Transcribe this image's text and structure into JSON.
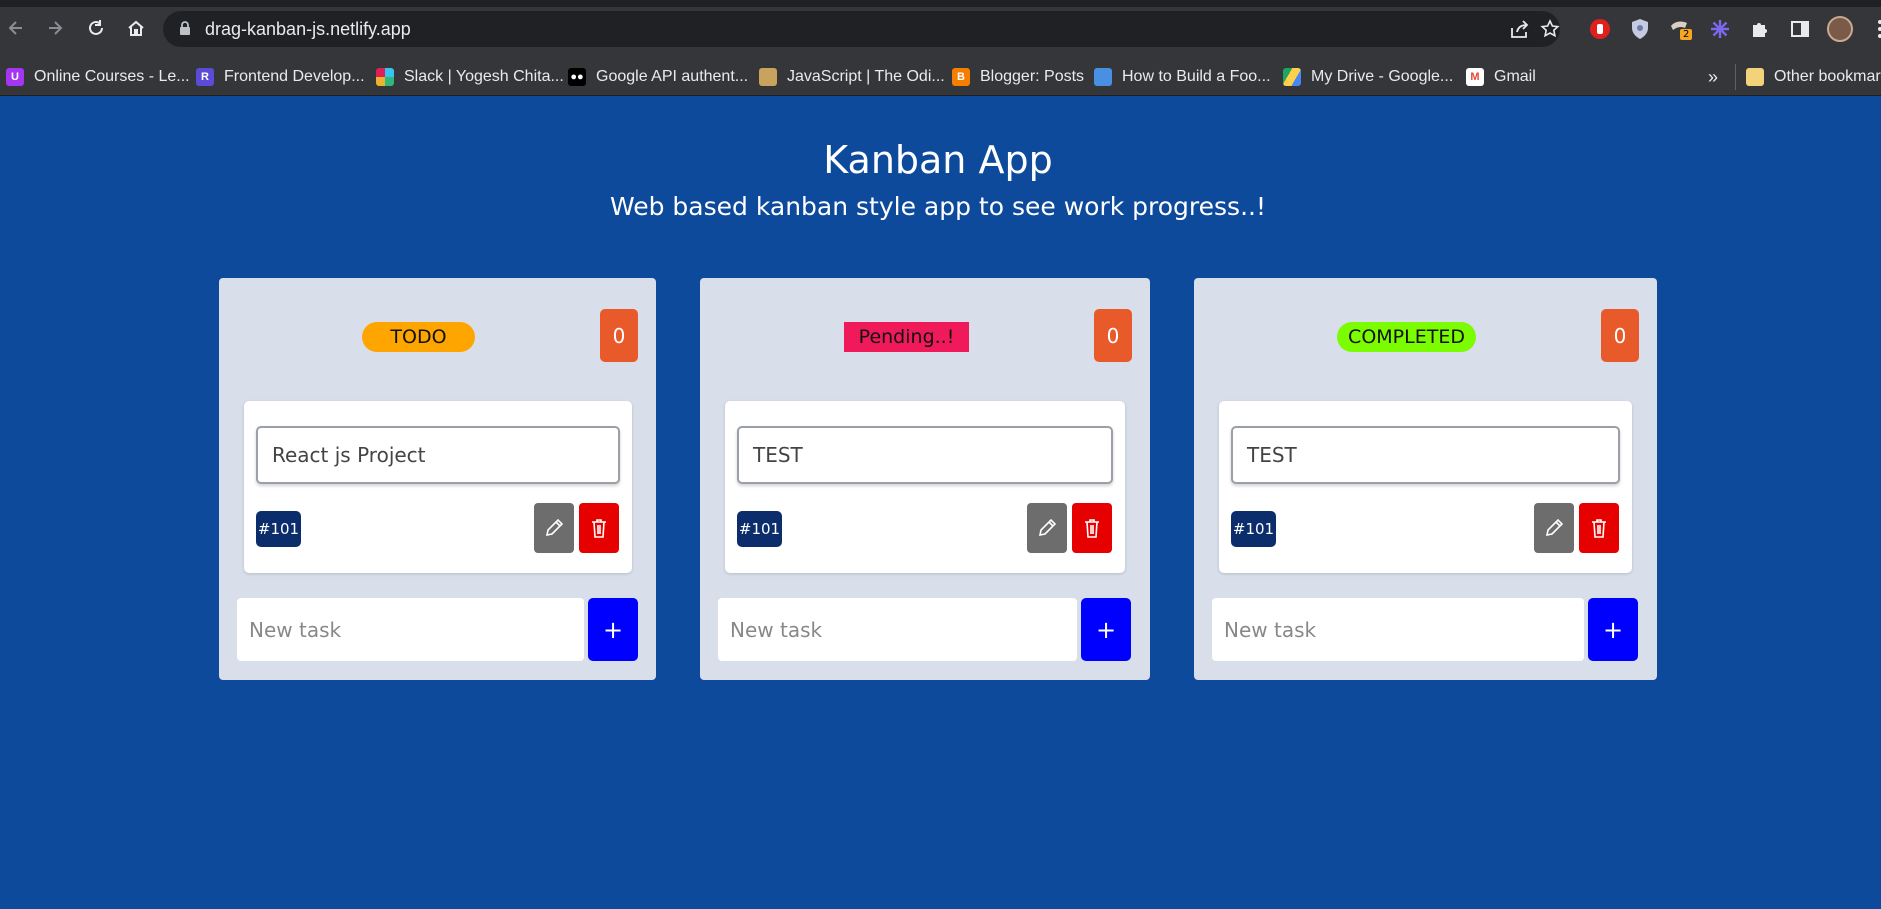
{
  "browser": {
    "url": "drag-kanban-js.netlify.app",
    "profile_badge": "2",
    "bookmarks": [
      {
        "label": "Online Courses - Le...",
        "icon": "udemy-icon",
        "color": "#a435f0"
      },
      {
        "label": "Frontend Develop...",
        "icon": "r-icon",
        "color": "#5b4bd6"
      },
      {
        "label": "Slack | Yogesh Chita...",
        "icon": "slack-icon",
        "color": "#e01e5a"
      },
      {
        "label": "Google API authent...",
        "icon": "medium-icon",
        "color": "#000000"
      },
      {
        "label": "JavaScript | The Odi...",
        "icon": "odin-icon",
        "color": "#c8a25f"
      },
      {
        "label": "Blogger: Posts",
        "icon": "blogger-icon",
        "color": "#f57d00"
      },
      {
        "label": "How to Build a Foo...",
        "icon": "monitor-icon",
        "color": "#4a90e2"
      },
      {
        "label": "My Drive - Google...",
        "icon": "drive-icon",
        "color": "#1fa463"
      },
      {
        "label": "Gmail",
        "icon": "gmail-icon",
        "color": "#ea4335"
      }
    ],
    "overflow": "»",
    "other_bookmarks": "Other bookmarks"
  },
  "app": {
    "title": "Kanban App",
    "subtitle": "Web based kanban style app to see work progress..!"
  },
  "columns": [
    {
      "label": "TODO",
      "label_color": "#ffa500",
      "count": "0",
      "card": {
        "text": "React js Project",
        "id": "#101"
      },
      "new_task_placeholder": "New task",
      "add_label": "+"
    },
    {
      "label": "Pending..!",
      "label_color": "#f01a5a",
      "count": "0",
      "card": {
        "text": "TEST",
        "id": "#101"
      },
      "new_task_placeholder": "New task",
      "add_label": "+"
    },
    {
      "label": "COMPLETED",
      "label_color": "#7cfc00",
      "count": "0",
      "card": {
        "text": "TEST",
        "id": "#101"
      },
      "new_task_placeholder": "New task",
      "add_label": "+"
    }
  ],
  "colors": {
    "page_bg": "#0e4a9c",
    "column_bg": "#d8deea",
    "count_bg": "#e95a2a",
    "id_bg": "#0b2d6b",
    "edit_bg": "#6d6d6d",
    "delete_bg": "#e60000",
    "add_bg": "#0000ff"
  }
}
